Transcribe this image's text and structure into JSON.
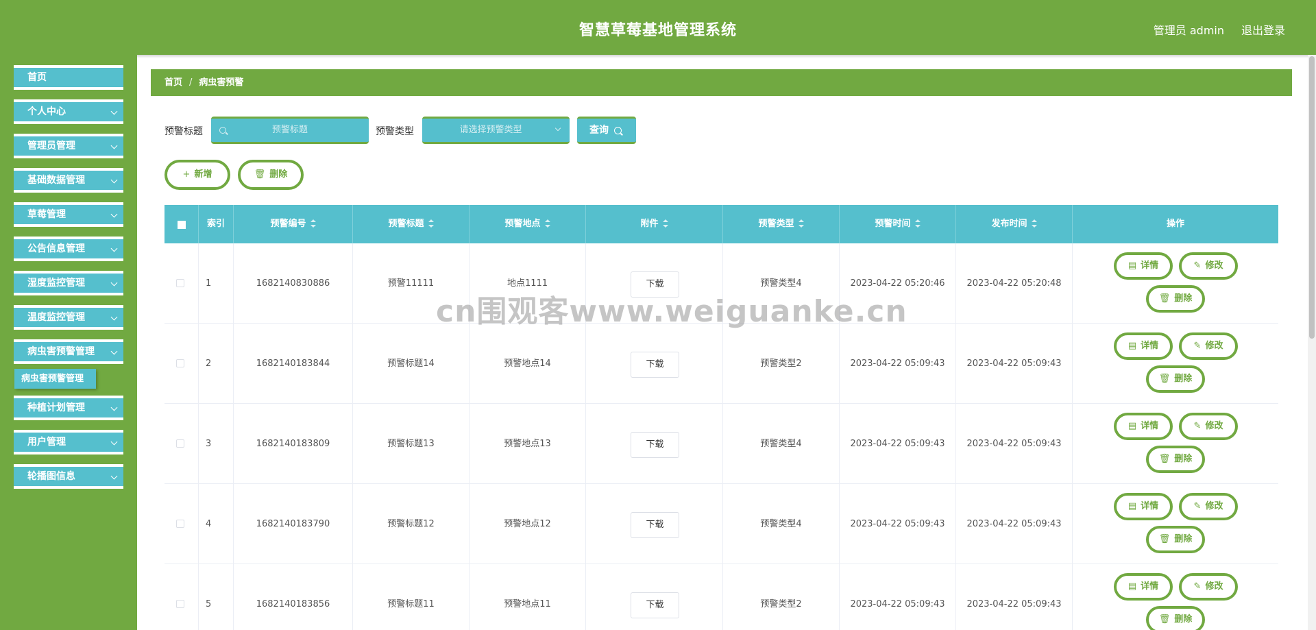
{
  "header": {
    "title": "智慧草莓基地管理系统",
    "user_label": "管理员 admin",
    "logout_label": "退出登录"
  },
  "sidebar": {
    "items": [
      {
        "label": "首页",
        "has_children": false
      },
      {
        "label": "个人中心",
        "has_children": true
      },
      {
        "label": "管理员管理",
        "has_children": true
      },
      {
        "label": "基础数据管理",
        "has_children": true
      },
      {
        "label": "草莓管理",
        "has_children": true
      },
      {
        "label": "公告信息管理",
        "has_children": true
      },
      {
        "label": "湿度监控管理",
        "has_children": true
      },
      {
        "label": "温度监控管理",
        "has_children": true
      },
      {
        "label": "病虫害预警管理",
        "has_children": true
      },
      {
        "label": "种植计划管理",
        "has_children": true
      },
      {
        "label": "用户管理",
        "has_children": true
      },
      {
        "label": "轮播图信息",
        "has_children": true
      }
    ],
    "open_submenu": "病虫害预警管理"
  },
  "breadcrumb": {
    "home": "首页",
    "separator": "/",
    "current": "病虫害预警"
  },
  "search": {
    "title_label": "预警标题",
    "title_placeholder": "预警标题",
    "type_label": "预警类型",
    "type_placeholder": "请选择预警类型",
    "query_label": "查询"
  },
  "actions": {
    "add_label": "新增",
    "delete_label": "删除"
  },
  "table": {
    "headers": [
      "索引",
      "预警编号",
      "预警标题",
      "预警地点",
      "附件",
      "预警类型",
      "预警时间",
      "发布时间",
      "操作"
    ],
    "rows": [
      {
        "index": "1",
        "code": "1682140830886",
        "title": "预警11111",
        "location": "地点1111",
        "attachment": "下载",
        "type": "预警类型4",
        "warn_time": "2023-04-22 05:20:46",
        "publish_time": "2023-04-22 05:20:48"
      },
      {
        "index": "2",
        "code": "1682140183844",
        "title": "预警标题14",
        "location": "预警地点14",
        "attachment": "下载",
        "type": "预警类型2",
        "warn_time": "2023-04-22 05:09:43",
        "publish_time": "2023-04-22 05:09:43"
      },
      {
        "index": "3",
        "code": "1682140183809",
        "title": "预警标题13",
        "location": "预警地点13",
        "attachment": "下载",
        "type": "预警类型4",
        "warn_time": "2023-04-22 05:09:43",
        "publish_time": "2023-04-22 05:09:43"
      },
      {
        "index": "4",
        "code": "1682140183790",
        "title": "预警标题12",
        "location": "预警地点12",
        "attachment": "下载",
        "type": "预警类型4",
        "warn_time": "2023-04-22 05:09:43",
        "publish_time": "2023-04-22 05:09:43"
      },
      {
        "index": "5",
        "code": "1682140183856",
        "title": "预警标题11",
        "location": "预警地点11",
        "attachment": "下载",
        "type": "预警类型2",
        "warn_time": "2023-04-22 05:09:43",
        "publish_time": "2023-04-22 05:09:43"
      }
    ],
    "row_actions": {
      "detail": "详情",
      "edit": "修改",
      "delete": "删除"
    }
  },
  "watermark": "cn围观客www.weiguanke.cn",
  "colors": {
    "primary_green": "#71a941",
    "accent_teal": "#55bfcd",
    "white": "#ffffff"
  }
}
